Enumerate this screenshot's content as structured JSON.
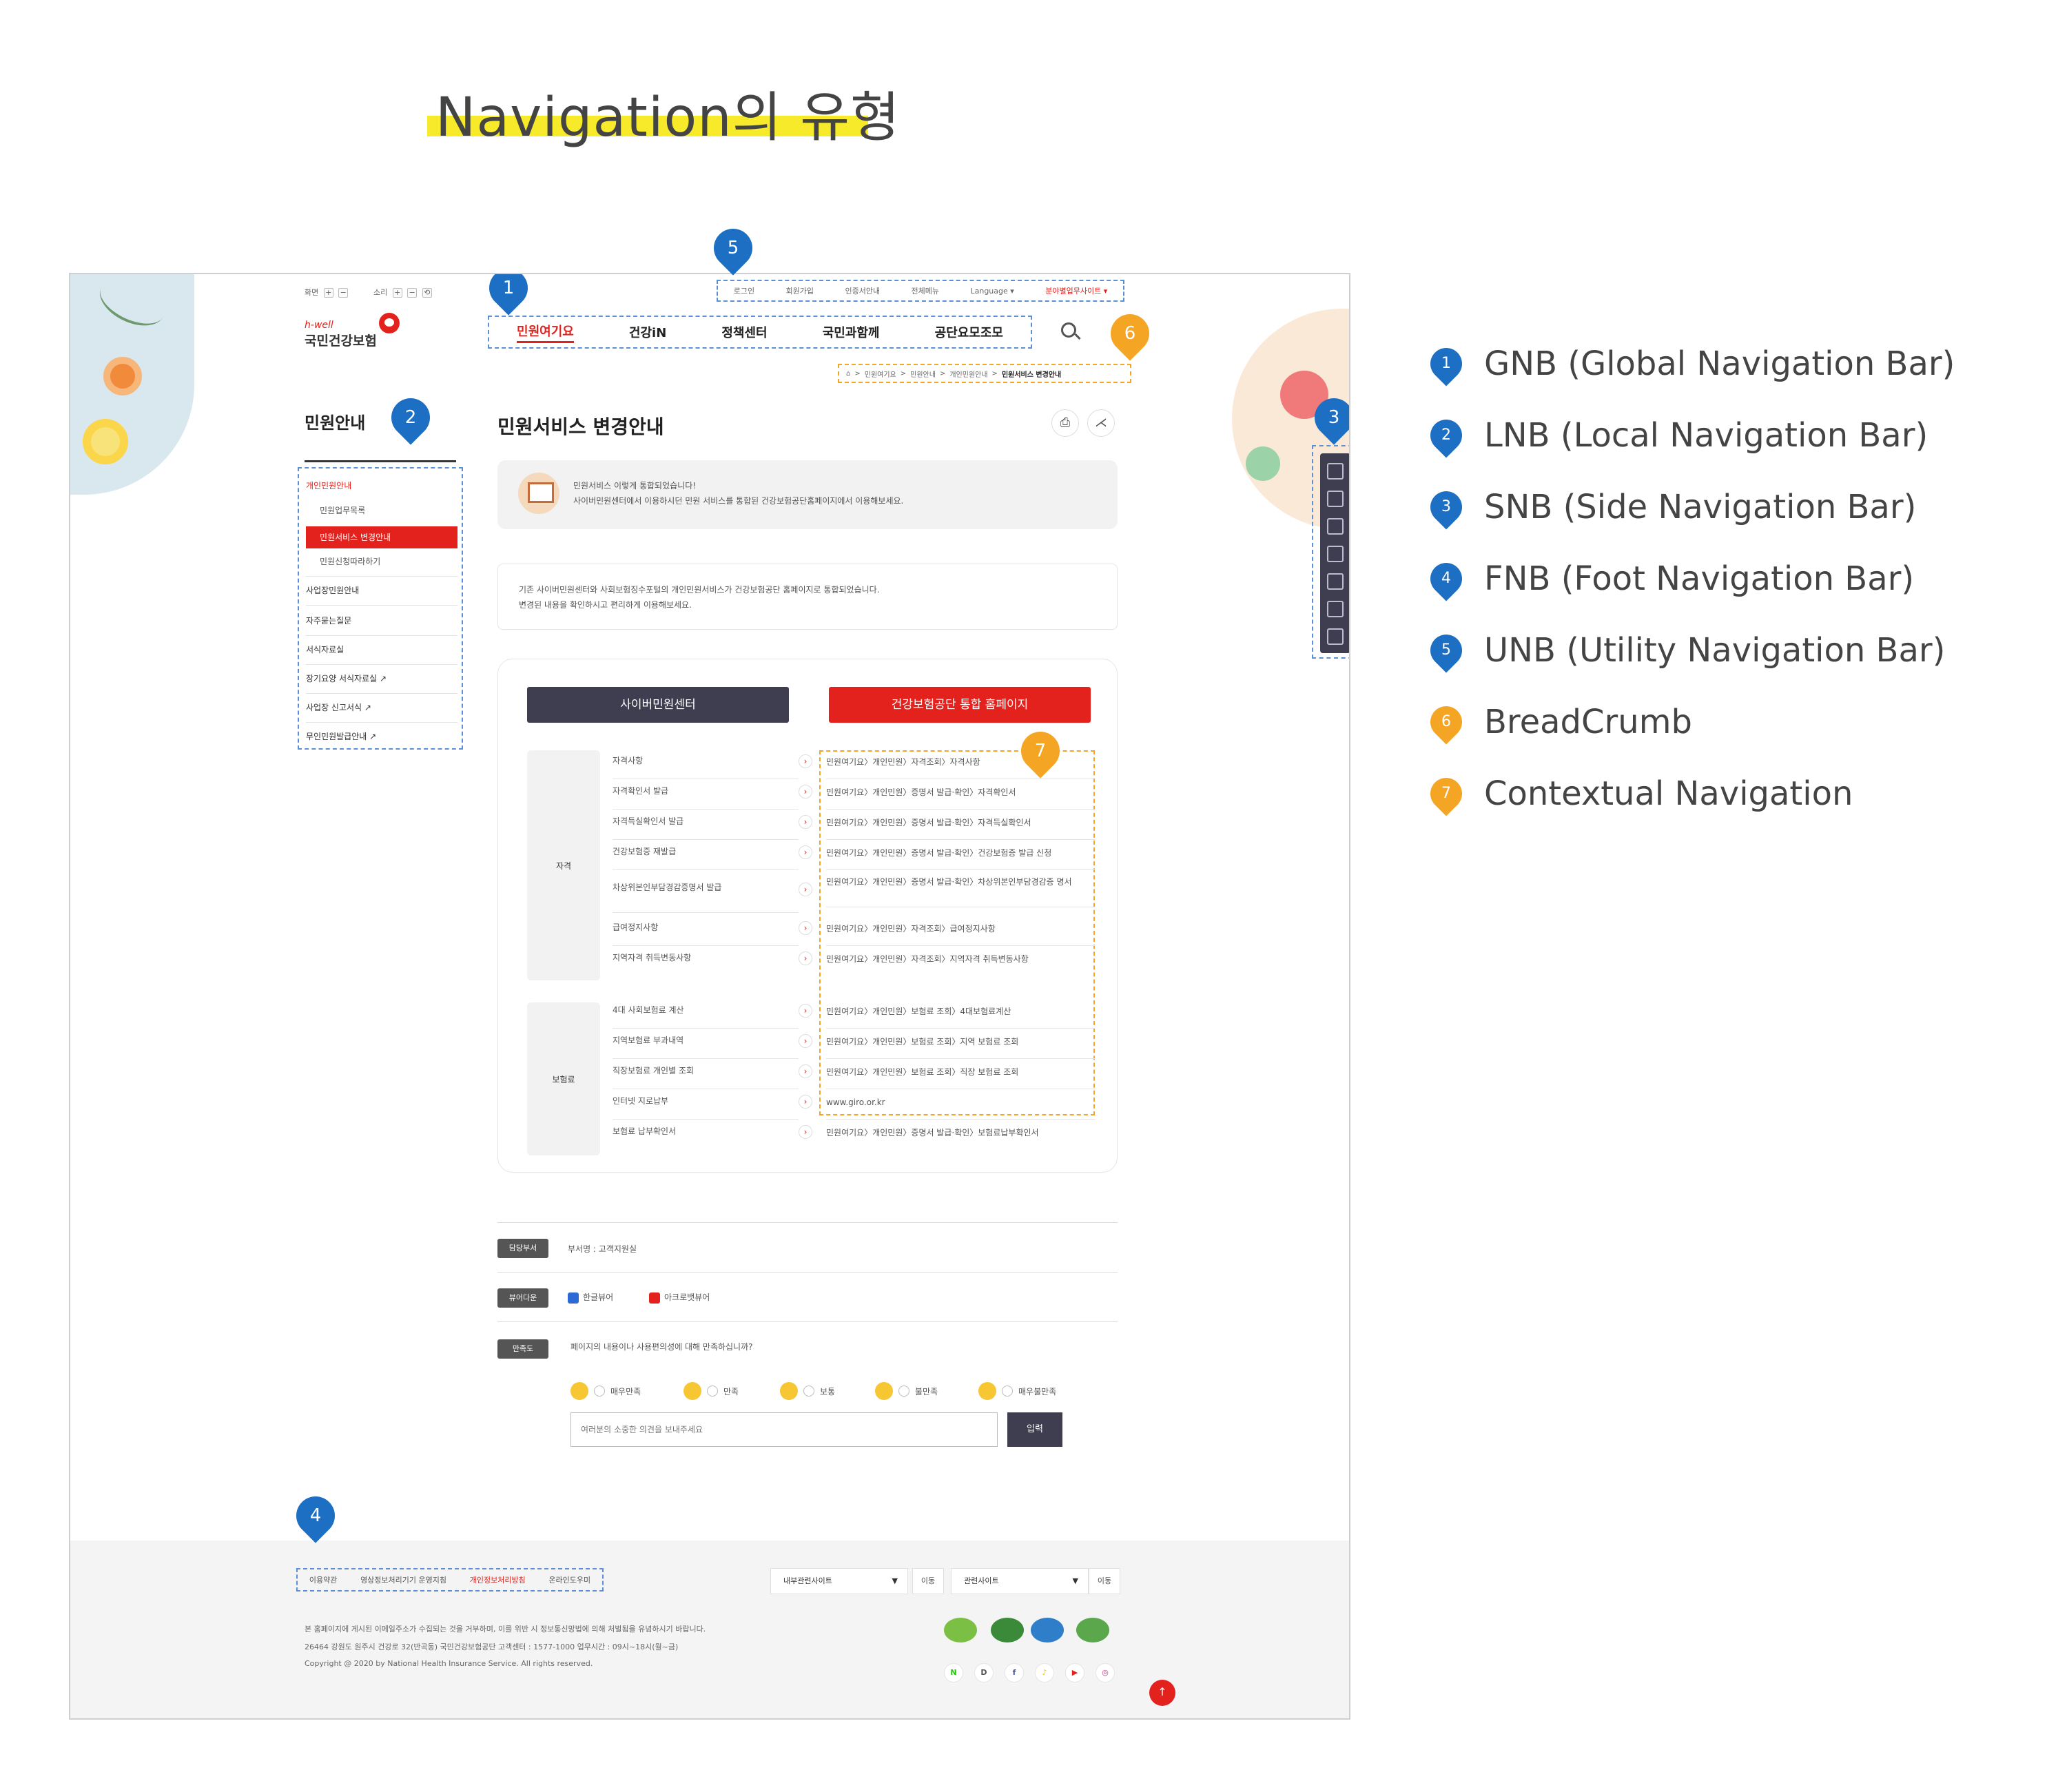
{
  "heading": "Navigation의 유형",
  "top_controls": {
    "screen_label": "화면",
    "sound_label": "소리",
    "plus": "+",
    "minus": "−",
    "reset": "⟲"
  },
  "logo": {
    "sub": "h-well",
    "main": "국민건강보험"
  },
  "unb": {
    "items": [
      "로그인",
      "회원가입",
      "인증서안내",
      "전체메뉴",
      "Language ▾",
      "분야별업무사이트 ▾"
    ]
  },
  "gnb": {
    "items": [
      "민원여기요",
      "건강iN",
      "정책센터",
      "국민과함께",
      "공단요모조모"
    ]
  },
  "breadcrumb": {
    "items": [
      "⌂",
      "민원여기요",
      "민원안내",
      "개인민원안내",
      "민원서비스 변경안내"
    ],
    "sep": ">"
  },
  "lnb": {
    "title": "민원안내",
    "items": [
      {
        "label": "개인민원안내",
        "state": "open"
      },
      {
        "label": "민원업무목록"
      },
      {
        "label": "민원서비스 변경안내",
        "state": "active"
      },
      {
        "label": "민원신청따라하기"
      },
      {
        "label": "사업장민원안내"
      },
      {
        "label": "자주묻는질문"
      },
      {
        "label": "서식자료실"
      },
      {
        "label": "장기요양 서식자료실 ↗"
      },
      {
        "label": "사업장 신고서식 ↗"
      },
      {
        "label": "무인민원발급안내 ↗"
      }
    ]
  },
  "content": {
    "title": "민원서비스 변경안내",
    "print_icon": "⎙",
    "share_icon": "⋌",
    "notice": [
      "민원서비스 이렇게 통합되었습니다!",
      "사이버민원센터에서 이용하시던 민원 서비스를 통합된 건강보험공단홈페이지에서 이용해보세요."
    ],
    "desc": [
      "기존 사이버민원센터와 사회보험징수포털의 개인민원서비스가 건강보험공단 홈페이지로 통합되었습니다.",
      "변경된 내용을 확인하시고 편리하게 이용해보세요."
    ],
    "btn_left": "사이버민원센터",
    "btn_right": "건강보험공단 통합 홈페이지",
    "groups": [
      {
        "name": "자격",
        "rows": [
          {
            "label": "자격사항",
            "path": "민원여기요〉개인민원〉자격조회〉자격사항"
          },
          {
            "label": "자격확인서 발급",
            "path": "민원여기요〉개인민원〉증명서 발급·확인〉자격확인서"
          },
          {
            "label": "자격득실확인서 발급",
            "path": "민원여기요〉개인민원〉증명서 발급·확인〉자격득실확인서"
          },
          {
            "label": "건강보험증 재발급",
            "path": "민원여기요〉개인민원〉증명서 발급·확인〉건강보험증 발급 신청"
          },
          {
            "label": "차상위본인부담경감증명서 발급",
            "path": "민원여기요〉개인민원〉증명서 발급·확인〉차상위본인부담경감증 명서"
          },
          {
            "label": "급여정지사항",
            "path": "민원여기요〉개인민원〉자격조회〉급여정지사항"
          },
          {
            "label": "지역자격 취득변동사항",
            "path": "민원여기요〉개인민원〉자격조회〉지역자격 취득변동사항"
          }
        ]
      },
      {
        "name": "보험료",
        "rows": [
          {
            "label": "4대 사회보험료 계산",
            "path": "민원여기요〉개인민원〉보험료 조회〉4대보험료계산"
          },
          {
            "label": "지역보험료 부과내역",
            "path": "민원여기요〉개인민원〉보험료 조회〉지역 보험료 조회"
          },
          {
            "label": "직장보험료 개인별 조회",
            "path": "민원여기요〉개인민원〉보험료 조회〉직장 보험료 조회"
          },
          {
            "label": "인터넷 지로납부",
            "path": "www.giro.or.kr"
          },
          {
            "label": "보험료 납부확인서",
            "path": "민원여기요〉개인민원〉증명서 발급·확인〉보험료납부확인서"
          }
        ]
      }
    ],
    "arrow": "›"
  },
  "info": {
    "dept_tag": "담당부서",
    "dept_value": "부서명 : 고객지원실",
    "viewer_tag": "뷰어다운",
    "viewer_hwp": "한글뷰어",
    "viewer_pdf": "아크로뱃뷰어",
    "sat_tag": "만족도",
    "sat_question": "페이지의 내용이나 사용편의성에 대해 만족하십니까?",
    "sat_options": [
      "매우만족",
      "만족",
      "보통",
      "불만족",
      "매우불만족"
    ],
    "opinion_placeholder": "여러분의 소중한 의견을 보내주세요",
    "submit": "입력"
  },
  "footer": {
    "fnb": [
      "이용약관",
      "영상정보처리기기 운영지침",
      "개인정보처리방침",
      "온라인도우미"
    ],
    "select1": "내부관련사이트",
    "select2": "관련사이트",
    "go": "이동",
    "caret": "▼",
    "line1": "본 홈페이지에 게시된 이메일주소가 수집되는 것을 거부하며, 이를 위반 시 정보통신망법에 의해 처벌됨을 유념하시기 바랍니다.",
    "line2": "26464 강원도 원주시 건강로 32(반곡동) 국민건강보험공단 고객센터 : 1577-1000 업무시간 : 09시~18시(월~금)",
    "line3": "Copyright @ 2020 by National Health Insurance Service. All rights reserved.",
    "social": [
      "N",
      "D",
      "f",
      "♪",
      "▶",
      "◎"
    ],
    "top": "↑"
  },
  "markers": [
    "1",
    "2",
    "3",
    "4",
    "5",
    "6",
    "7"
  ],
  "legend": [
    {
      "num": "1",
      "text": "GNB (Global Navigation Bar)",
      "color": "#1d6fc4"
    },
    {
      "num": "2",
      "text": "LNB (Local Navigation Bar)",
      "color": "#1d6fc4"
    },
    {
      "num": "3",
      "text": "SNB (Side Navigation Bar)",
      "color": "#1d6fc4"
    },
    {
      "num": "4",
      "text": "FNB (Foot Navigation Bar)",
      "color": "#1d6fc4"
    },
    {
      "num": "5",
      "text": "UNB (Utility Navigation Bar)",
      "color": "#1d6fc4"
    },
    {
      "num": "6",
      "text": "BreadCrumb",
      "color": "#f5a524"
    },
    {
      "num": "7",
      "text": "Contextual Navigation",
      "color": "#f5a524"
    }
  ],
  "colors": {
    "accent_red": "#e3221d",
    "marker_blue": "#1d6fc4",
    "marker_orange": "#f5a524",
    "highlight": "#f6ea2b",
    "dark_button": "#3e3e50"
  }
}
